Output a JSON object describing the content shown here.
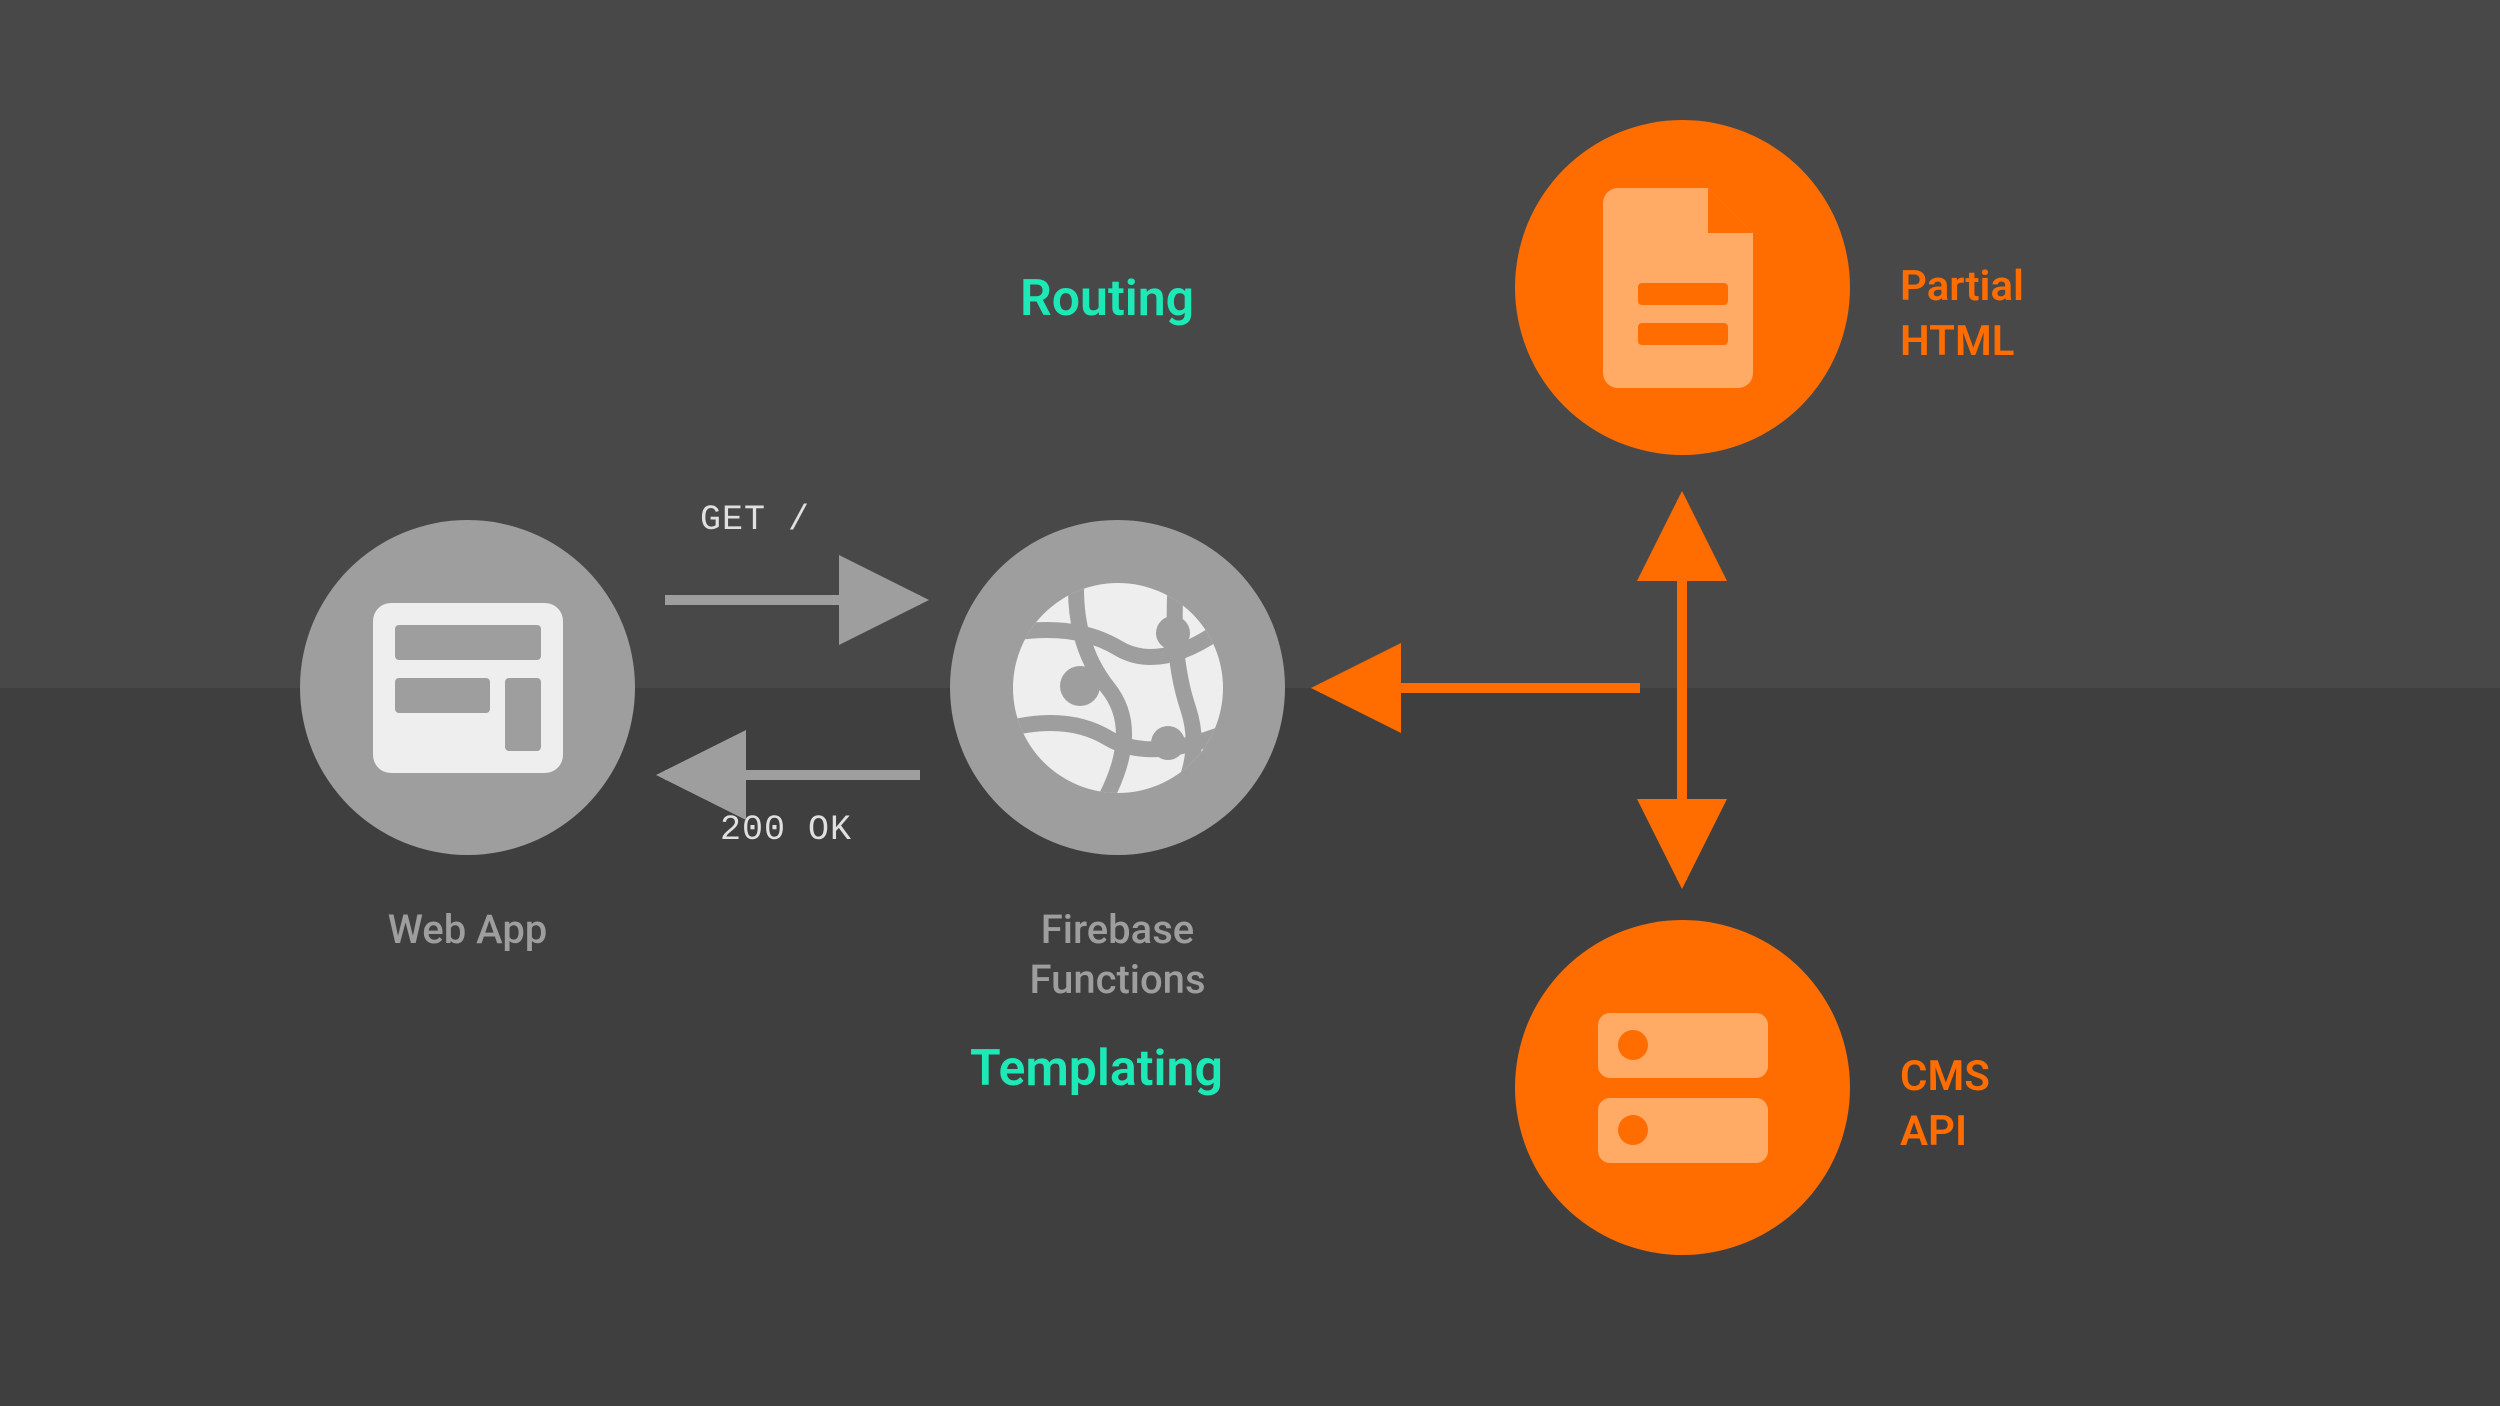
{
  "title_top": "Routing",
  "title_bottom": "Templating",
  "nodes": {
    "web_app": {
      "label": "Web App"
    },
    "firebase": {
      "label": "Firebase\nFunctions"
    },
    "partial_html": {
      "label": "Partial\nHTML"
    },
    "cms_api": {
      "label": "CMS\nAPI"
    }
  },
  "arrows": {
    "request": "GET /",
    "response": "200 OK"
  },
  "colors": {
    "bg_top": "#484848",
    "bg_bottom": "#3f3f3f",
    "gray": "#9e9e9e",
    "light_gray_icon": "#eeeeee",
    "orange": "#ff6d00",
    "orange_light": "#ffab66",
    "teal": "#1de9b6"
  }
}
